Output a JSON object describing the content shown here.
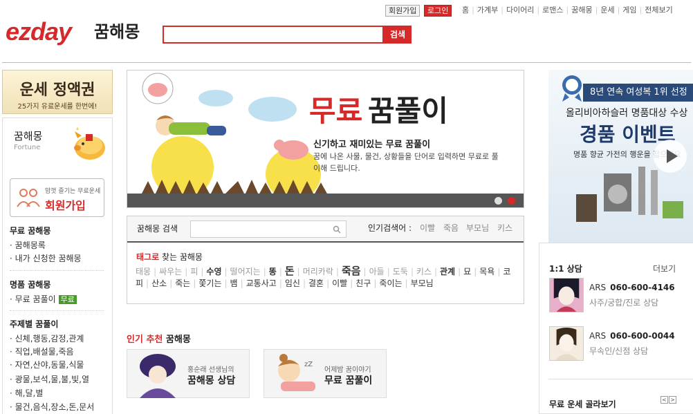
{
  "header": {
    "logo": "ezday",
    "logo_sub": "꿈해몽",
    "search_button": "검색",
    "search_value": "",
    "join_button": "회원가입",
    "login_button": "로그인",
    "nav": [
      "홈",
      "가계부",
      "다이어리",
      "로맨스",
      "꿈해몽",
      "운세",
      "게임",
      "전체보기"
    ]
  },
  "left": {
    "ad_title": "운세 정액권",
    "ad_sub": "25가지 유료운세를 한번에!",
    "box_title": "꿈해몽",
    "box_sub": "Fortune",
    "join_small": "맘껏 즐기는 무료운세",
    "join_big": "회원가입",
    "section1_title": "무료 꿈해몽",
    "section1_items": [
      "꿈해몽록",
      "내가 신청한 꿈해몽"
    ],
    "section2_title": "명품 꿈해몽",
    "section2_item": "무료 꿈풀이",
    "section2_badge": "무료",
    "section3_title": "주제별 꿈풀이",
    "section3_items": [
      "신체,행동,감정,관계",
      "직업,배설물,죽음",
      "자연,산야,동물,식물",
      "광물,보석,물,불,빛,열",
      "해,달,별",
      "물건,음식,장소,돈,문서"
    ]
  },
  "banner": {
    "title_red": "무료",
    "title_black": "꿈풀이",
    "headline": "신기하고 재미있는 무료 꿈풀이",
    "desc": "꿈에 나온 사물, 물건, 상황들을 단어로 입력하면 무료로 풀이해 드립니다."
  },
  "dream_search": {
    "label": "꿈해몽 검색",
    "input_value": "",
    "popular_label": "인기검색어 :",
    "popular": [
      "이빨",
      "죽음",
      "부모님",
      "키스"
    ],
    "tag_heading_red": "태그로",
    "tag_heading_rest": "찾는 꿈해몽",
    "tags": [
      {
        "t": "태몽",
        "s": "g"
      },
      {
        "t": "싸우는",
        "s": "g"
      },
      {
        "t": "피",
        "s": "g"
      },
      {
        "t": "수영",
        "s": "b"
      },
      {
        "t": "떨어지는",
        "s": "g"
      },
      {
        "t": "똥",
        "s": "b"
      },
      {
        "t": "돈",
        "s": "big"
      },
      {
        "t": "머리카락",
        "s": "g"
      },
      {
        "t": "죽음",
        "s": "big"
      },
      {
        "t": "아들",
        "s": "g"
      },
      {
        "t": "도둑",
        "s": "g"
      },
      {
        "t": "키스",
        "s": "g"
      },
      {
        "t": "관계",
        "s": "b"
      },
      {
        "t": "묘",
        "s": "n"
      },
      {
        "t": "목욕",
        "s": "n"
      },
      {
        "t": "코피",
        "s": "n"
      },
      {
        "t": "산소",
        "s": "n"
      },
      {
        "t": "죽는",
        "s": "n"
      },
      {
        "t": "쫓기는",
        "s": "n"
      },
      {
        "t": "뱀",
        "s": "n"
      },
      {
        "t": "교통사고",
        "s": "n"
      },
      {
        "t": "임신",
        "s": "n"
      },
      {
        "t": "결혼",
        "s": "n"
      },
      {
        "t": "이빨",
        "s": "n"
      },
      {
        "t": "친구",
        "s": "n"
      },
      {
        "t": "죽이는",
        "s": "n"
      },
      {
        "t": "부모님",
        "s": "n"
      }
    ]
  },
  "recommend": {
    "heading_red": "인기 추천",
    "heading_rest": "꿈해몽",
    "cards": [
      {
        "small": "홍순래 선생님의",
        "main": "꿈해몽 상담"
      },
      {
        "small": "어제밤 꿈이야기",
        "main": "무료 꿈풀이"
      }
    ]
  },
  "right": {
    "ad_line1": "8년 연속 여성복 1위 선정",
    "ad_line2": "올리비아하슬러 명품대상 수상",
    "ad_line3": "경품 이벤트",
    "ad_line4": "명품 향균 가전의 행운을 잡으세요",
    "consult_title": "1:1 상담",
    "more": "더보기",
    "consultants": [
      {
        "ars": "ARS",
        "phone": "060-600-4146",
        "desc": "사주/궁합/진로 상담"
      },
      {
        "ars": "ARS",
        "phone": "060-600-0044",
        "desc": "무속인/신점 상담"
      }
    ],
    "free_title": "무료 운세 골라보기",
    "arrow_prev": "<",
    "arrow_next": ">"
  },
  "colors": {
    "accent": "#d62a2a",
    "badge": "#4a9a2a"
  }
}
